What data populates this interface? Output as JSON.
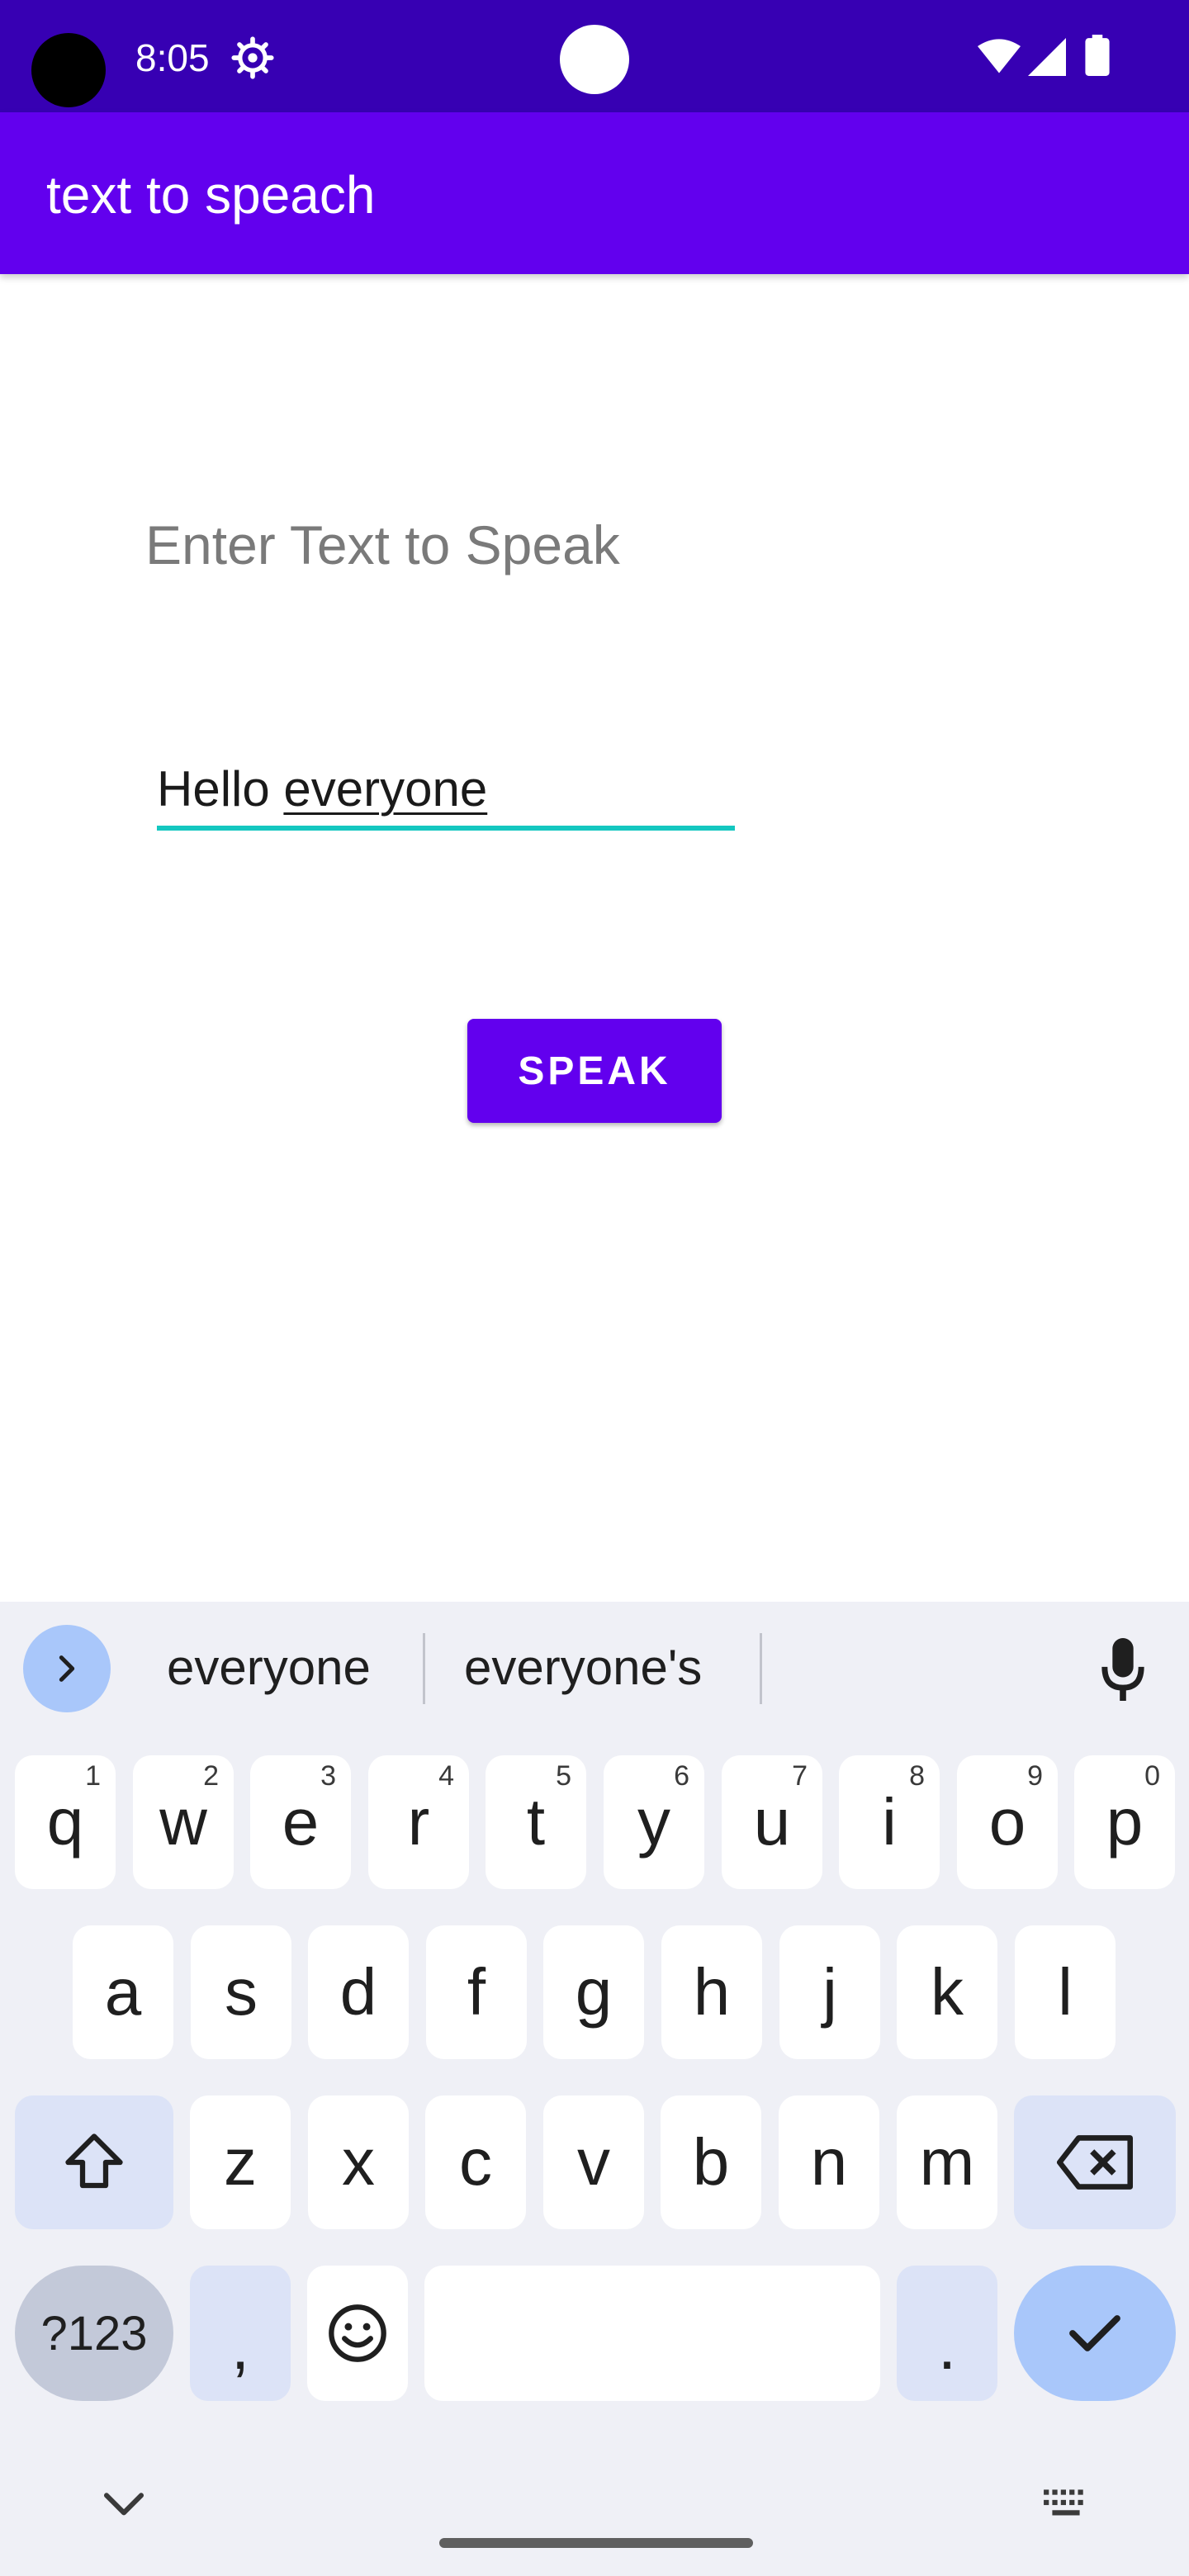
{
  "status_bar": {
    "time": "8:05",
    "icons": [
      "camera-hole",
      "gear-icon",
      "wifi-icon",
      "signal-icon",
      "battery-icon"
    ]
  },
  "app_bar": {
    "title": "text to speach",
    "color": "#6200ee"
  },
  "main": {
    "prompt": "Enter Text to Speak",
    "input": {
      "value_prefix": "Hello ",
      "value_composing": "everyone",
      "underline_color": "#14c7c0"
    },
    "speak_button": {
      "label": "SPEAK",
      "color": "#6200ee"
    }
  },
  "keyboard": {
    "suggestions": [
      "everyone",
      "everyone's"
    ],
    "rows": [
      [
        {
          "k": "q",
          "h": "1"
        },
        {
          "k": "w",
          "h": "2"
        },
        {
          "k": "e",
          "h": "3"
        },
        {
          "k": "r",
          "h": "4"
        },
        {
          "k": "t",
          "h": "5"
        },
        {
          "k": "y",
          "h": "6"
        },
        {
          "k": "u",
          "h": "7"
        },
        {
          "k": "i",
          "h": "8"
        },
        {
          "k": "o",
          "h": "9"
        },
        {
          "k": "p",
          "h": "0"
        }
      ],
      [
        {
          "k": "a"
        },
        {
          "k": "s"
        },
        {
          "k": "d"
        },
        {
          "k": "f"
        },
        {
          "k": "g"
        },
        {
          "k": "h"
        },
        {
          "k": "j"
        },
        {
          "k": "k"
        },
        {
          "k": "l"
        }
      ],
      [
        {
          "k": "z"
        },
        {
          "k": "x"
        },
        {
          "k": "c"
        },
        {
          "k": "v"
        },
        {
          "k": "b"
        },
        {
          "k": "n"
        },
        {
          "k": "m"
        }
      ]
    ],
    "symbols_label": "?123",
    "comma_label": ",",
    "period_label": ".",
    "accent_color": "#a9c7fa"
  }
}
